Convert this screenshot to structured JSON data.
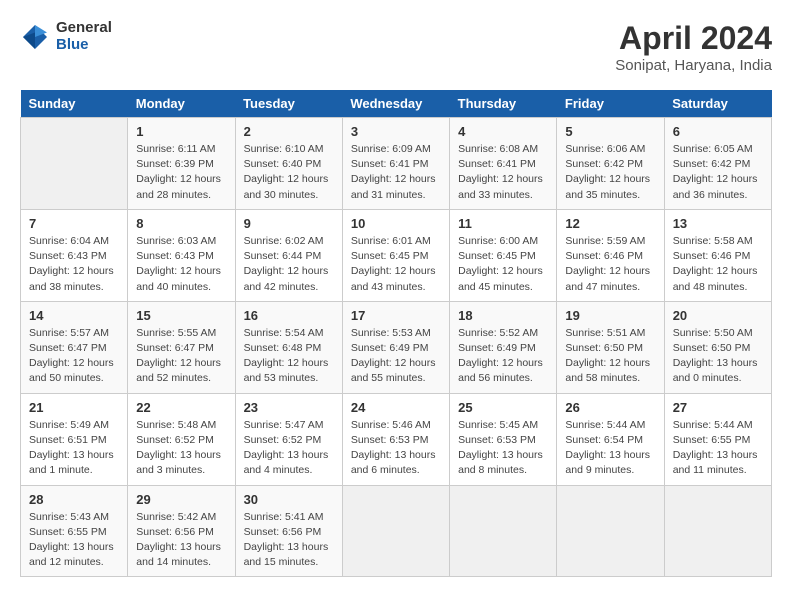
{
  "logo": {
    "general": "General",
    "blue": "Blue"
  },
  "title": "April 2024",
  "subtitle": "Sonipat, Haryana, India",
  "days_of_week": [
    "Sunday",
    "Monday",
    "Tuesday",
    "Wednesday",
    "Thursday",
    "Friday",
    "Saturday"
  ],
  "weeks": [
    [
      {
        "day": "",
        "info": ""
      },
      {
        "day": "1",
        "info": "Sunrise: 6:11 AM\nSunset: 6:39 PM\nDaylight: 12 hours\nand 28 minutes."
      },
      {
        "day": "2",
        "info": "Sunrise: 6:10 AM\nSunset: 6:40 PM\nDaylight: 12 hours\nand 30 minutes."
      },
      {
        "day": "3",
        "info": "Sunrise: 6:09 AM\nSunset: 6:41 PM\nDaylight: 12 hours\nand 31 minutes."
      },
      {
        "day": "4",
        "info": "Sunrise: 6:08 AM\nSunset: 6:41 PM\nDaylight: 12 hours\nand 33 minutes."
      },
      {
        "day": "5",
        "info": "Sunrise: 6:06 AM\nSunset: 6:42 PM\nDaylight: 12 hours\nand 35 minutes."
      },
      {
        "day": "6",
        "info": "Sunrise: 6:05 AM\nSunset: 6:42 PM\nDaylight: 12 hours\nand 36 minutes."
      }
    ],
    [
      {
        "day": "7",
        "info": "Sunrise: 6:04 AM\nSunset: 6:43 PM\nDaylight: 12 hours\nand 38 minutes."
      },
      {
        "day": "8",
        "info": "Sunrise: 6:03 AM\nSunset: 6:43 PM\nDaylight: 12 hours\nand 40 minutes."
      },
      {
        "day": "9",
        "info": "Sunrise: 6:02 AM\nSunset: 6:44 PM\nDaylight: 12 hours\nand 42 minutes."
      },
      {
        "day": "10",
        "info": "Sunrise: 6:01 AM\nSunset: 6:45 PM\nDaylight: 12 hours\nand 43 minutes."
      },
      {
        "day": "11",
        "info": "Sunrise: 6:00 AM\nSunset: 6:45 PM\nDaylight: 12 hours\nand 45 minutes."
      },
      {
        "day": "12",
        "info": "Sunrise: 5:59 AM\nSunset: 6:46 PM\nDaylight: 12 hours\nand 47 minutes."
      },
      {
        "day": "13",
        "info": "Sunrise: 5:58 AM\nSunset: 6:46 PM\nDaylight: 12 hours\nand 48 minutes."
      }
    ],
    [
      {
        "day": "14",
        "info": "Sunrise: 5:57 AM\nSunset: 6:47 PM\nDaylight: 12 hours\nand 50 minutes."
      },
      {
        "day": "15",
        "info": "Sunrise: 5:55 AM\nSunset: 6:47 PM\nDaylight: 12 hours\nand 52 minutes."
      },
      {
        "day": "16",
        "info": "Sunrise: 5:54 AM\nSunset: 6:48 PM\nDaylight: 12 hours\nand 53 minutes."
      },
      {
        "day": "17",
        "info": "Sunrise: 5:53 AM\nSunset: 6:49 PM\nDaylight: 12 hours\nand 55 minutes."
      },
      {
        "day": "18",
        "info": "Sunrise: 5:52 AM\nSunset: 6:49 PM\nDaylight: 12 hours\nand 56 minutes."
      },
      {
        "day": "19",
        "info": "Sunrise: 5:51 AM\nSunset: 6:50 PM\nDaylight: 12 hours\nand 58 minutes."
      },
      {
        "day": "20",
        "info": "Sunrise: 5:50 AM\nSunset: 6:50 PM\nDaylight: 13 hours\nand 0 minutes."
      }
    ],
    [
      {
        "day": "21",
        "info": "Sunrise: 5:49 AM\nSunset: 6:51 PM\nDaylight: 13 hours\nand 1 minute."
      },
      {
        "day": "22",
        "info": "Sunrise: 5:48 AM\nSunset: 6:52 PM\nDaylight: 13 hours\nand 3 minutes."
      },
      {
        "day": "23",
        "info": "Sunrise: 5:47 AM\nSunset: 6:52 PM\nDaylight: 13 hours\nand 4 minutes."
      },
      {
        "day": "24",
        "info": "Sunrise: 5:46 AM\nSunset: 6:53 PM\nDaylight: 13 hours\nand 6 minutes."
      },
      {
        "day": "25",
        "info": "Sunrise: 5:45 AM\nSunset: 6:53 PM\nDaylight: 13 hours\nand 8 minutes."
      },
      {
        "day": "26",
        "info": "Sunrise: 5:44 AM\nSunset: 6:54 PM\nDaylight: 13 hours\nand 9 minutes."
      },
      {
        "day": "27",
        "info": "Sunrise: 5:44 AM\nSunset: 6:55 PM\nDaylight: 13 hours\nand 11 minutes."
      }
    ],
    [
      {
        "day": "28",
        "info": "Sunrise: 5:43 AM\nSunset: 6:55 PM\nDaylight: 13 hours\nand 12 minutes."
      },
      {
        "day": "29",
        "info": "Sunrise: 5:42 AM\nSunset: 6:56 PM\nDaylight: 13 hours\nand 14 minutes."
      },
      {
        "day": "30",
        "info": "Sunrise: 5:41 AM\nSunset: 6:56 PM\nDaylight: 13 hours\nand 15 minutes."
      },
      {
        "day": "",
        "info": ""
      },
      {
        "day": "",
        "info": ""
      },
      {
        "day": "",
        "info": ""
      },
      {
        "day": "",
        "info": ""
      }
    ]
  ]
}
